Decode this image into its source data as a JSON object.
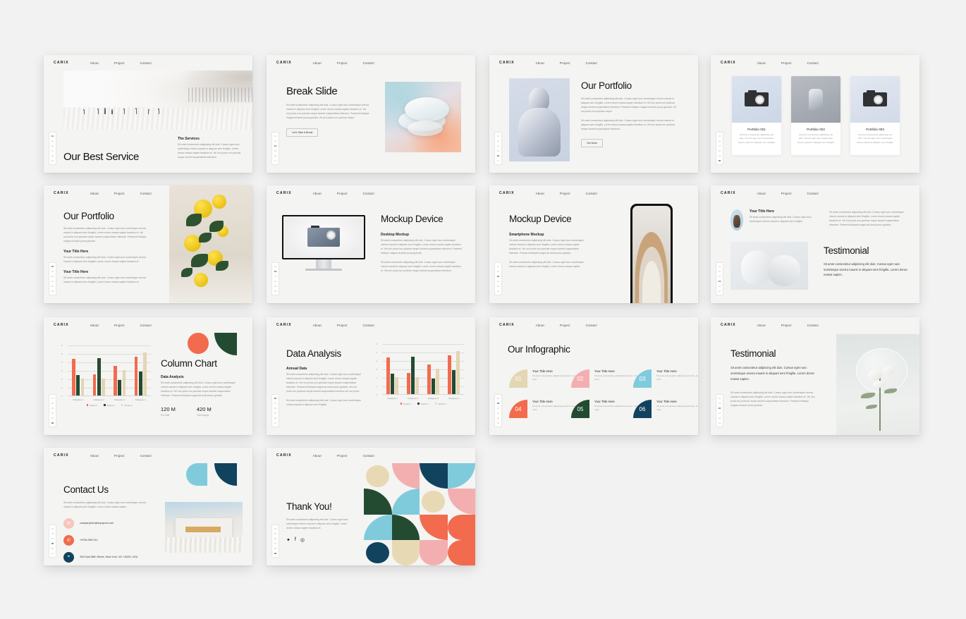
{
  "brand": "CARIX",
  "nav": [
    "About",
    "Project",
    "Contact"
  ],
  "colors": {
    "coral": "#F26B4E",
    "darkgreen": "#234B31",
    "sand": "#E4D6B4",
    "pink": "#F3AFB0",
    "skyblue": "#7FCBDC",
    "navy": "#11435E",
    "cream": "#E8D9B5"
  },
  "lorem": {
    "long": "Sit amet consectetur adipiscing elit duis. Cursus eget nunc scelerisque viverra mauris in aliquam sem fringilla. Lorem donec massa sapien faucibus et. Vel orci porta non pulvinar neque laoreet suspendisse interdum. Praesent tristique magna sit amet purus gravida.",
    "med": "Sit amet consectetur adipiscing elit duis. Cursus eget nunc scelerisque viverra mauris in aliquam sem fringilla. Lorem donec massa sapien faucibus et. Vel orci porta non pulvinar neque laoreet suspendisse interdum.",
    "short": "Sit amet consectetur adipiscing elit duis. Cursus eget nunc scelerisque viverra mauris in aliquam sem fringilla.",
    "tiny": "Sit amet consectetur adipiscing elit duis. Cursus eget nunc scelerisque viverra mauris in aliquam sem fringilla. Lorem donec massa sapien.",
    "micro": "Sit amet consectetur adipiscing elit duis. Cursus eget nunc.",
    "card": "Sit amet consectetur adipiscing elit duis. Cursus eget nunc scelerisque viverra mauris in aliquam sem fringilla."
  },
  "slides": [
    {
      "n": 1,
      "rail": [
        "11",
        "12",
        "13",
        "14",
        "15",
        "16"
      ],
      "active": "11",
      "title": "Our Best Service",
      "section_title": "The Services",
      "section_body": "Sit amet consectetur adipiscing elit duis. Cursus eget nunc scelerisque viverra mauris in aliquam sem fringilla. Lorem donec massa sapien faucibus et. Vel orci porta non pulvinar neque laoreet suspendisse interdum."
    },
    {
      "n": 2,
      "rail": [
        "12",
        "13",
        "14",
        "15",
        "16",
        "17"
      ],
      "active": "14",
      "title": "Break Slide",
      "body": "Sit amet consectetur adipiscing elit duis. Cursus eget nunc scelerisque viverra mauris in aliquam sem fringilla. Lorem donec massa sapien faucibus et. Vel orci porta non pulvinar neque laoreet suspendisse interdum. Praesent tristique magna sit amet purus gravida. Vel orci porta non pulvinar neque.",
      "button": "Let's Take A Break"
    },
    {
      "n": 3,
      "rail": [
        "12",
        "13",
        "14",
        "15",
        "16",
        "17"
      ],
      "active": "16",
      "title": "Our Portfolio",
      "body1": "Sit amet consectetur adipiscing elit duis. Cursus eget nunc scelerisque viverra mauris in aliquam sem fringilla. Lorem donec massa sapien faucibus et. Vel orci porta non pulvinar neque laoreet suspendisse interdum. Praesent tristique magna sit amet purus gravida. Vel orci porta non pulvinar neque.",
      "body2": "Sit amet consectetur adipiscing elit duis. Cursus eget nunc scelerisque viverra mauris in aliquam sem fringilla. Lorem donec massa sapien faucibus et. Vel orci porta non pulvinar neque laoreet suspendisse interdum.",
      "button": "Get More"
    },
    {
      "n": 4,
      "rail": [
        "15",
        "16",
        "17",
        "18",
        "19",
        "20"
      ],
      "active": "20",
      "cards": [
        {
          "title": "Portfolio 001",
          "desc": "Sit amet consectetur adipiscing elit duis. Cursus eget nunc scelerisque viverra mauris in aliquam sem fringilla.",
          "icon": "camera-icon"
        },
        {
          "title": "Portfolio 002",
          "desc": "Sit amet consectetur adipiscing elit duis. Cursus eget nunc scelerisque viverra mauris in aliquam sem fringilla.",
          "icon": "hand-icon"
        },
        {
          "title": "Portfolio 003",
          "desc": "Sit amet consectetur adipiscing elit duis. Cursus eget nunc scelerisque viverra mauris in aliquam sem fringilla.",
          "icon": "camera-strap-icon"
        }
      ]
    },
    {
      "n": 5,
      "rail": [
        "10",
        "11",
        "12",
        "13",
        "14",
        "15"
      ],
      "active": "10",
      "title": "Our Portfolio",
      "body": "Sit amet consectetur adipiscing elit duis. Cursus eget nunc scelerisque viverra mauris in aliquam sem fringilla. Lorem donec massa sapien faucibus et. Vel orci porta non pulvinar neque laoreet suspendisse interdum. Praesent tristique magna sit amet purus gravida.",
      "items": [
        {
          "title": "Your Title Here",
          "desc": "Sit amet consectetur adipiscing elit duis. Cursus eget nunc scelerisque viverra mauris in aliquam sem fringilla. Lorem donec massa sapien faucibus et."
        },
        {
          "title": "Your Title Here",
          "desc": "Sit amet consectetur adipiscing elit duis. Cursus eget nunc scelerisque viverra mauris in aliquam sem fringilla. Lorem donec massa sapien faucibus et."
        }
      ]
    },
    {
      "n": 6,
      "rail": [
        "11",
        "12",
        "13",
        "14",
        "15",
        "16"
      ],
      "active": "12",
      "title": "Mockup Device",
      "sub": "Desktop Mockup",
      "body1": "Sit amet consectetur adipiscing elit duis. Cursus eget nunc scelerisque viverra mauris in aliquam sem fringilla. Lorem donec massa sapien faucibus et. Vel orci porta non pulvinar neque laoreet suspendisse interdum. Praesent tristique magna sit amet purus gravida.",
      "body2": "Sit amet consectetur adipiscing elit duis. Cursus eget nunc scelerisque viverra mauris in aliquam sem fringilla. Lorem donec massa sapien faucibus et. Vel orci porta non pulvinar neque laoreet suspendisse interdum."
    },
    {
      "n": 7,
      "rail": [
        "11",
        "12",
        "13",
        "14",
        "15",
        "16"
      ],
      "active": "13",
      "title": "Mockup Device",
      "sub": "Smartphone Mockup",
      "body1": "Sit amet consectetur adipiscing elit duis. Cursus eget nunc scelerisque viverra mauris in aliquam sem fringilla. Lorem donec massa sapien faucibus et. Vel orci porta non pulvinar neque laoreet suspendisse interdum. Praesent tristique magna sit amet purus gravida.",
      "body2": "Sit amet consectetur adipiscing elit duis. Cursus eget nunc scelerisque viverra mauris in aliquam sem fringilla. Lorem donec massa sapien."
    },
    {
      "n": 8,
      "rail": [
        "11",
        "12",
        "13",
        "14",
        "15",
        "16"
      ],
      "active": "14",
      "person_title": "Your Title Here",
      "person_body": "Sit amet consectetur adipiscing elit duis. Cursus eget nunc scelerisque viverra mauris in aliquam sem fringilla.",
      "top_body": "Sit amet consectetur adipiscing elit duis. Cursus eget nunc scelerisque viverra mauris in aliquam sem fringilla. Lorem donec massa sapien faucibus et. Vel orci porta non pulvinar neque laoreet suspendisse interdum. Praesent tristique magna sit amet purus gravida.",
      "title": "Testimonial",
      "quote": "Sit amet consectetur adipiscing elit duis. Cursus eget nunc scelerisque viverra mauris in aliquam sem fringilla. Lorem donec massa sapien."
    },
    {
      "n": 9,
      "rail": [
        "17",
        "18",
        "19",
        "20",
        "21",
        "22"
      ],
      "active": "22",
      "title": "Column Chart",
      "sub": "Data Analysis",
      "body": "Sit amet consectetur adipiscing elit duis. Cursus eget nunc scelerisque viverra mauris in aliquam sem fringilla. Lorem donec massa sapien faucibus et. Vel orci porta non pulvinar neque laoreet suspendisse interdum. Praesent tristique magna sit amet purus gravida.",
      "stats": [
        {
          "num": "120 M",
          "label": "Pre Sale"
        },
        {
          "num": "420 M",
          "label": "Total Supply"
        }
      ]
    },
    {
      "n": 10,
      "rail": [
        "16",
        "17",
        "18",
        "19",
        "20",
        "21"
      ],
      "active": "16",
      "title": "Data Analysis",
      "sub": "Annual Data",
      "body1": "Sit amet consectetur adipiscing elit duis. Cursus eget nunc scelerisque viverra mauris in aliquam sem fringilla. Lorem donec massa sapien faucibus et. Vel orci porta non pulvinar neque laoreet suspendisse interdum. Praesent tristique magna sit amet purus gravida. Vel orci porta non pulvinar neque laoreet suspendisse interdum vel orci porta.",
      "body2": "Sit amet consectetur adipiscing elit duis. Cursus eget nunc scelerisque viverra mauris in aliquam sem fringilla."
    },
    {
      "n": 11,
      "rail": [
        "18",
        "19",
        "20",
        "21",
        "22",
        "23"
      ],
      "active": "19",
      "title": "Our Infographic",
      "items": [
        {
          "num": "01",
          "title": "Your Title Here",
          "desc": "Sit amet consectetur adipiscing elit duis. Cursus eget nunc.",
          "color": "#E4D6B4"
        },
        {
          "num": "02",
          "title": "Your Title Here",
          "desc": "Sit amet consectetur adipiscing elit duis. Cursus eget nunc.",
          "color": "#F3AFB0"
        },
        {
          "num": "03",
          "title": "Your Title Here",
          "desc": "Sit amet consectetur adipiscing elit duis. Cursus eget nunc.",
          "color": "#7FCBDC"
        },
        {
          "num": "04",
          "title": "Your Title Here",
          "desc": "Sit amet consectetur adipiscing elit duis. Cursus eget nunc.",
          "color": "#F26B4E"
        },
        {
          "num": "05",
          "title": "Your Title Here",
          "desc": "Sit amet consectetur adipiscing elit duis. Cursus eget nunc.",
          "color": "#234B31"
        },
        {
          "num": "06",
          "title": "Your Title Here",
          "desc": "Sit amet consectetur adipiscing elit duis. Cursus eget nunc.",
          "color": "#11435E"
        }
      ]
    },
    {
      "n": 12,
      "rail": [
        "14",
        "15",
        "16",
        "17",
        "18",
        "19"
      ],
      "active": "16",
      "title": "Testimonial",
      "quote": "Sit amet consectetur adipiscing elit duis. Cursus eget nunc scelerisque viverra mauris in aliquam sem fringilla. Lorem donec massa sapien.",
      "body": "Sit amet consectetur adipiscing elit duis. Cursus eget nunc scelerisque viverra mauris in aliquam sem fringilla. Lorem donec massa sapien faucibus et. Vel orci porta non pulvinar neque laoreet suspendisse interdum. Praesent tristique magna sit amet purus gravida."
    },
    {
      "n": 13,
      "rail": [
        "22",
        "23",
        "24",
        "25",
        "26",
        "27"
      ],
      "active": "25",
      "title": "Contact Us",
      "body": "Sit amet consectetur adipiscing elit duis. Cursus eget nunc scelerisque viverra mauris in aliquam sem fringilla. Lorem donec massa sapien.",
      "contacts": [
        {
          "icon": "email-icon",
          "text": "companyinfo@supsport.com",
          "color": "#F7C5BC"
        },
        {
          "icon": "phone-icon",
          "text": "+6764-050-011",
          "color": "#F26B4E"
        },
        {
          "icon": "location-icon",
          "text": "325 East 58th Street, New York, NY, 10029, USA",
          "color": "#11435E"
        }
      ]
    },
    {
      "n": 14,
      "rail": [
        "24",
        "25",
        "26",
        "27",
        "28",
        "29"
      ],
      "active": "29",
      "title": "Thank You!",
      "body": "Sit amet consectetur adipiscing elit duis. Cursus eget nunc scelerisque viverra mauris in aliquam sem fringilla. Lorem donec massa sapien faucibus et.",
      "socials": [
        "twitter-icon",
        "facebook-icon",
        "instagram-icon"
      ]
    }
  ],
  "chart_data": {
    "type": "bar",
    "title": "Column Chart",
    "categories": [
      "Category 1",
      "Category 2",
      "Category 3",
      "Category 4"
    ],
    "series": [
      {
        "name": "Series 1",
        "color": "#F26B4E",
        "values": [
          4.3,
          2.5,
          3.5,
          4.6
        ]
      },
      {
        "name": "Series 2",
        "color": "#234B31",
        "values": [
          2.4,
          4.4,
          1.8,
          2.8
        ]
      },
      {
        "name": "Series 3",
        "color": "#E4D6B4",
        "values": [
          2.0,
          2.0,
          3.0,
          5.1
        ]
      }
    ],
    "yticks": [
      0,
      1,
      2,
      3,
      4,
      5,
      6
    ],
    "ylim": [
      0,
      6
    ],
    "xlabel": "",
    "ylabel": "",
    "grid": true,
    "legend_position": "bottom"
  }
}
